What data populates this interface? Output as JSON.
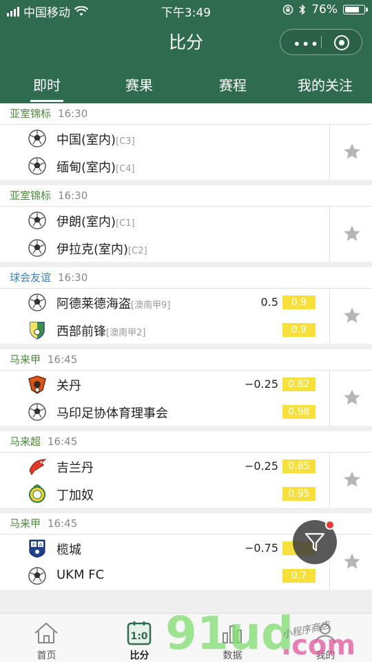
{
  "status_bar": {
    "carrier": "中国移动",
    "time": "下午3:49",
    "battery": "76%",
    "battery_level": 0.76
  },
  "header": {
    "title": "比分",
    "menu_icon": "more-dots-icon",
    "close_icon": "target-icon"
  },
  "tabs": [
    {
      "label": "即时",
      "active": true
    },
    {
      "label": "赛果",
      "active": false
    },
    {
      "label": "赛程",
      "active": false
    },
    {
      "label": "我的关注",
      "active": false
    }
  ],
  "matches": [
    {
      "competition": "亚室锦标",
      "time": "16:30",
      "color": "#4a8a3a",
      "home": {
        "name": "中国(室内)",
        "rank": "[C3]",
        "icon": "soccer-ball-icon"
      },
      "away": {
        "name": "缅甸(室内)",
        "rank": "[C4]",
        "icon": "soccer-ball-icon"
      },
      "handicap": "",
      "odds_home": "",
      "odds_away": ""
    },
    {
      "competition": "亚室锦标",
      "time": "16:30",
      "color": "#4a8a3a",
      "home": {
        "name": "伊朗(室内)",
        "rank": "[C1]",
        "icon": "soccer-ball-icon"
      },
      "away": {
        "name": "伊拉克(室内)",
        "rank": "[C2]",
        "icon": "soccer-ball-icon"
      },
      "handicap": "",
      "odds_home": "",
      "odds_away": ""
    },
    {
      "competition": "球会友谊",
      "time": "16:30",
      "color": "#3a7fc0",
      "home": {
        "name": "阿德莱德海盗",
        "rank": "[澳南甲9]",
        "icon": "soccer-ball-icon"
      },
      "away": {
        "name": "西部前锋",
        "rank": "[澳南甲2]",
        "icon": "club-shield-icon"
      },
      "handicap": "0.5",
      "odds_home": "0.9",
      "odds_away": "0.9"
    },
    {
      "competition": "马来甲",
      "time": "16:45",
      "color": "#4a8a3a",
      "home": {
        "name": "关丹",
        "rank": "",
        "icon": "club-crest-icon"
      },
      "away": {
        "name": "马印足协体育理事会",
        "rank": "",
        "icon": "soccer-ball-icon"
      },
      "handicap": "−0.25",
      "odds_home": "0.82",
      "odds_away": "0.98"
    },
    {
      "competition": "马来超",
      "time": "16:45",
      "color": "#4a8a3a",
      "home": {
        "name": "吉兰丹",
        "rank": "",
        "icon": "red-bird-crest-icon"
      },
      "away": {
        "name": "丁加奴",
        "rank": "",
        "icon": "yellow-crest-icon"
      },
      "handicap": "−0.25",
      "odds_home": "0.85",
      "odds_away": "0.95"
    },
    {
      "competition": "马来甲",
      "time": "16:45",
      "color": "#4a8a3a",
      "home": {
        "name": "榄城",
        "rank": "",
        "icon": "fa-badge-icon"
      },
      "away": {
        "name": "UKM FC",
        "rank": "",
        "icon": "soccer-ball-icon"
      },
      "handicap": "−0.75",
      "odds_home": "1.",
      "odds_away": "0.7"
    }
  ],
  "bottom_nav": [
    {
      "label": "首页",
      "icon": "home-icon",
      "active": false
    },
    {
      "label": "比分",
      "icon": "scoreboard-icon",
      "active": true
    },
    {
      "label": "数据",
      "icon": "bar-chart-icon",
      "active": false
    },
    {
      "label": "我的",
      "icon": "user-icon",
      "active": false
    }
  ],
  "watermark": {
    "text": "91ud.com",
    "caption": "小程序商店"
  },
  "colors": {
    "primary": "#2f6b4e",
    "odds_bg": "#f7e03c",
    "league": "#4a8a3a",
    "friendly": "#3a7fc0",
    "badge_dot": "#e53935"
  }
}
